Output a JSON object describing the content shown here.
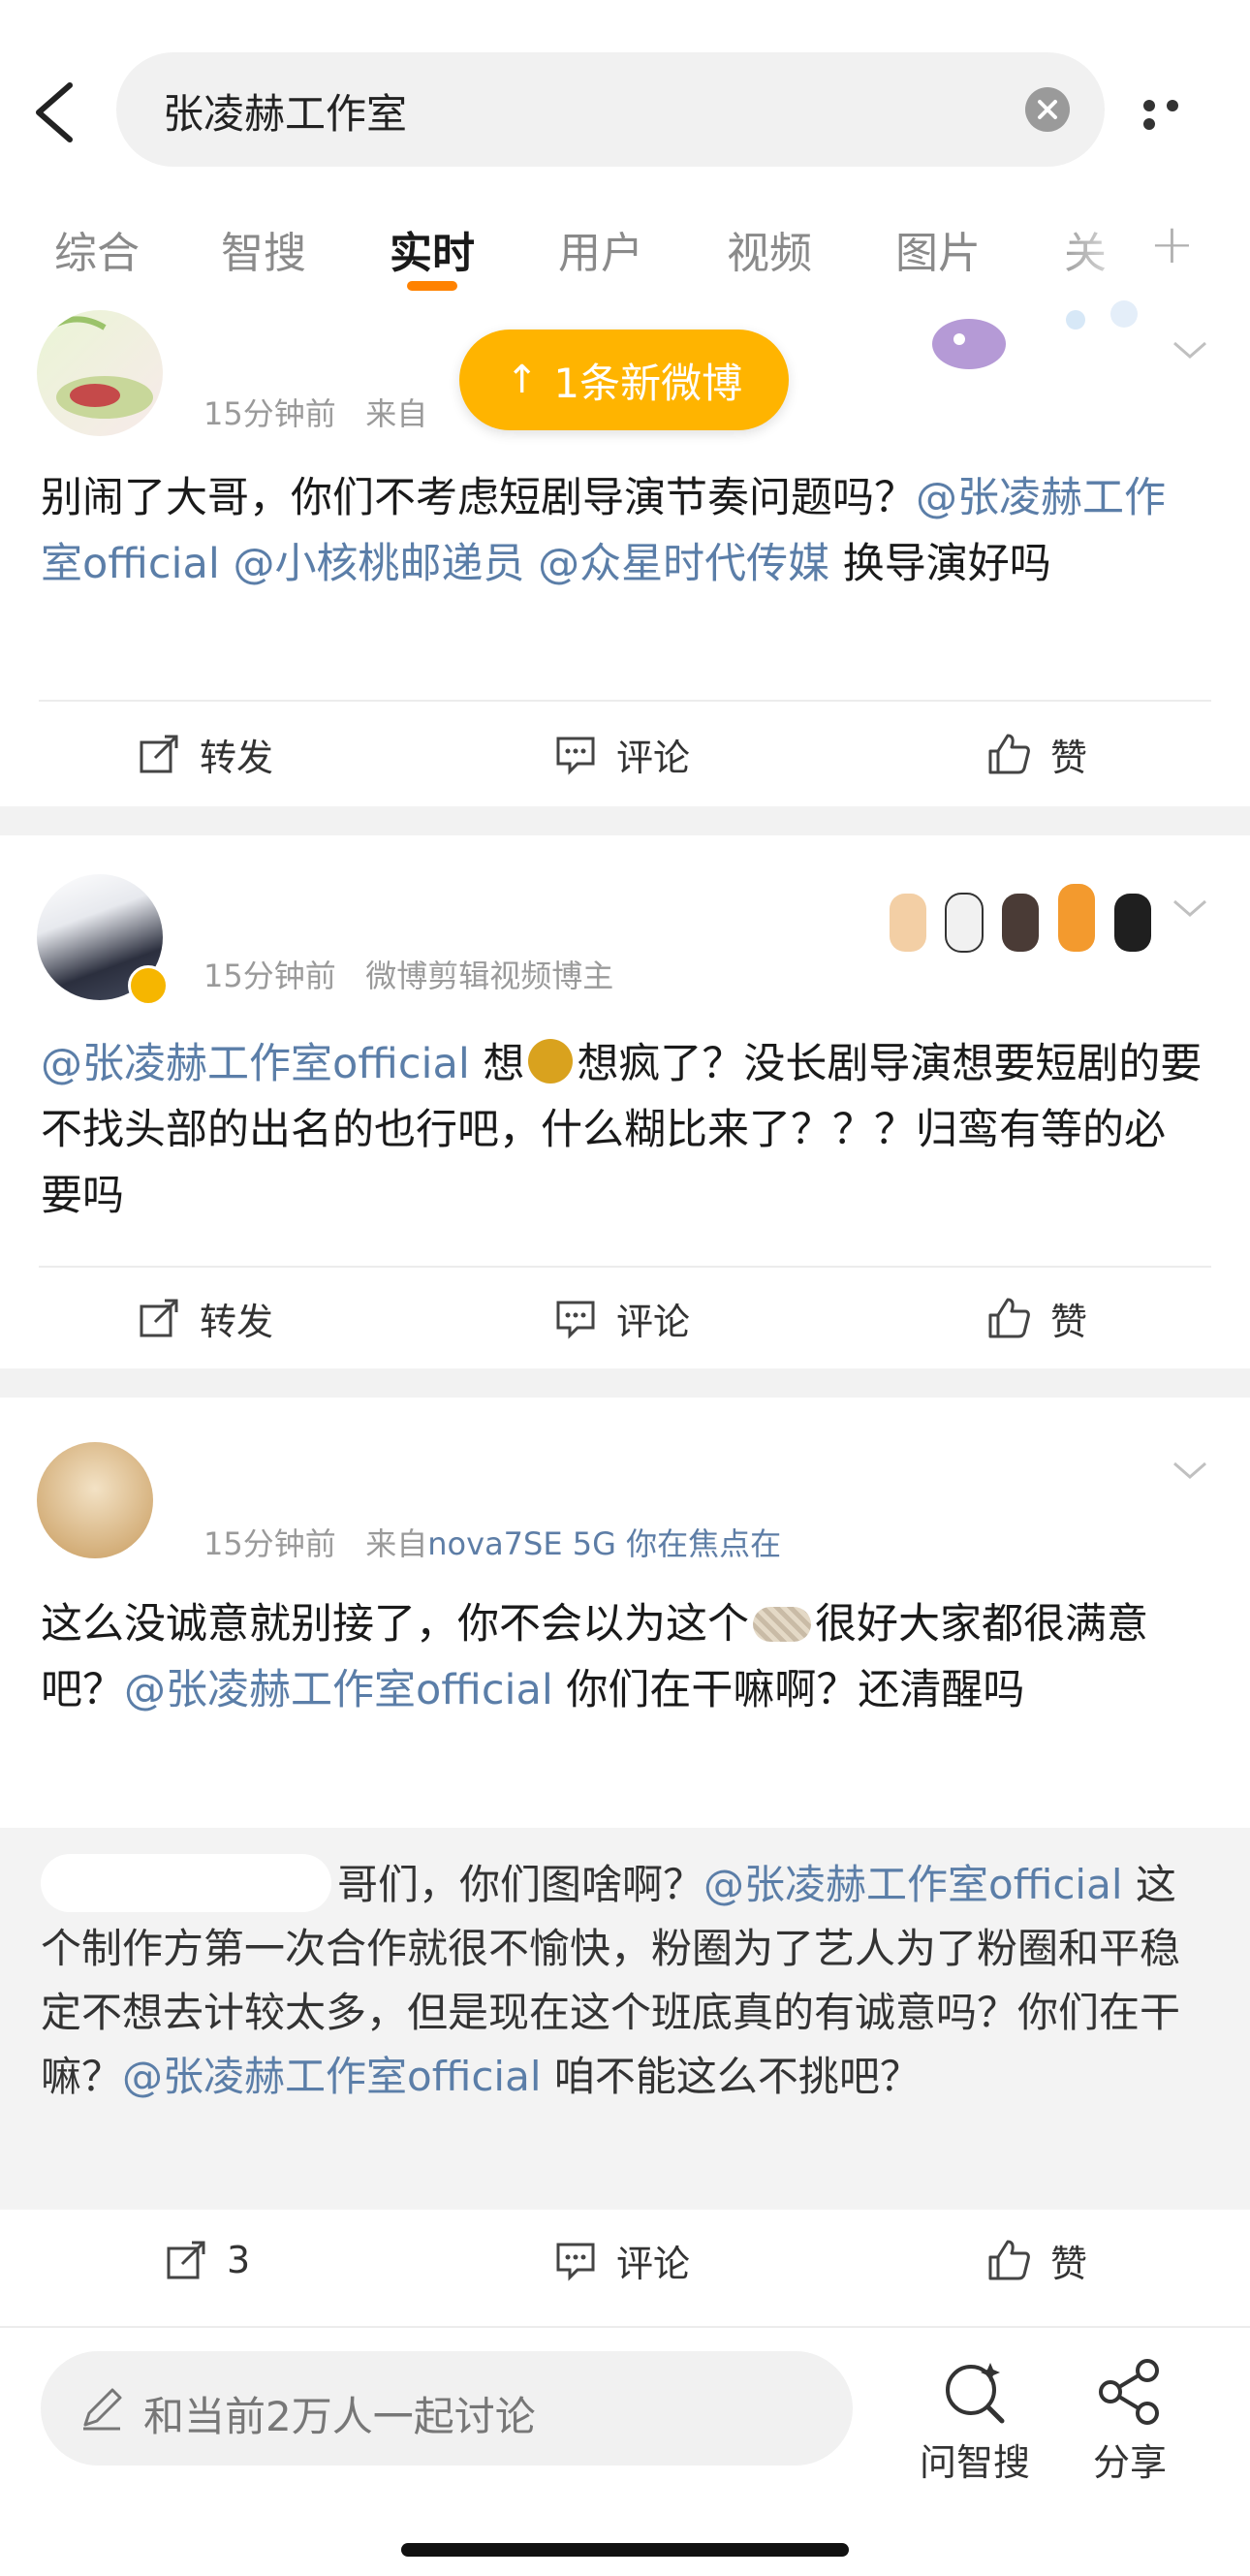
{
  "header": {
    "search_query": "张凌赫工作室"
  },
  "tabs": [
    {
      "label": "综合"
    },
    {
      "label": "智搜"
    },
    {
      "label": "实时"
    },
    {
      "label": "用户"
    },
    {
      "label": "视频"
    },
    {
      "label": "图片"
    },
    {
      "label": "关"
    }
  ],
  "active_tab": "实时",
  "new_posts_pill": "1条新微博",
  "posts": [
    {
      "time": "15分钟前",
      "source": "来自",
      "body": [
        {
          "t": "text",
          "v": "别闹了大哥，你们不考虑短剧导演节奏问题吗？"
        },
        {
          "t": "mention",
          "v": "@张凌赫工作室official"
        },
        {
          "t": "text",
          "v": " "
        },
        {
          "t": "mention",
          "v": "@小核桃邮递员"
        },
        {
          "t": "text",
          "v": " "
        },
        {
          "t": "mention",
          "v": "@众星时代传媒"
        },
        {
          "t": "text",
          "v": " 换导演好吗"
        }
      ],
      "actions": {
        "repost": "转发",
        "comment": "评论",
        "like": "赞"
      }
    },
    {
      "time": "15分钟前",
      "source": "微博剪辑视频博主",
      "body_a": "@张凌赫工作室official",
      "body_b": " 想",
      "body_c": "想疯了？没长剧导演想要短剧的要不找头部的出名的也行吧，什么糊比来了？？？归鸾有等的必要吗",
      "actions": {
        "repost": "转发",
        "comment": "评论",
        "like": "赞"
      }
    },
    {
      "time": "15分钟前",
      "source": "来自",
      "source_link": "nova7SE 5G 你在焦点在",
      "body_a": "这么没诚意就别接了，你不会以为这个",
      "body_b": "很好大家都很满意吧？",
      "body_c": "@张凌赫工作室official",
      "body_d": " 你们在干嘛啊？还清醒吗",
      "quote": {
        "a": "哥们，你们图啥啊？",
        "b": "@张凌赫工作室official",
        "c": " 这个制作方第一次合作就很不愉快，粉圈为了艺人为了粉圈和平稳定不想去计较太多，但是现在这个班底真的有诚意吗？你们在干嘛？",
        "d": "@张凌赫工作室official",
        "e": " 咱不能这么不挑吧？"
      },
      "actions": {
        "repost": "3",
        "comment": "评论",
        "like": "赞"
      }
    }
  ],
  "bottom_bar": {
    "placeholder": "和当前2万人一起讨论",
    "ask_label": "问智搜",
    "share_label": "分享"
  },
  "colors": {
    "accent_orange": "#ff8200",
    "pill_yellow": "#ffb400",
    "mention_blue": "#5b7ea8"
  }
}
